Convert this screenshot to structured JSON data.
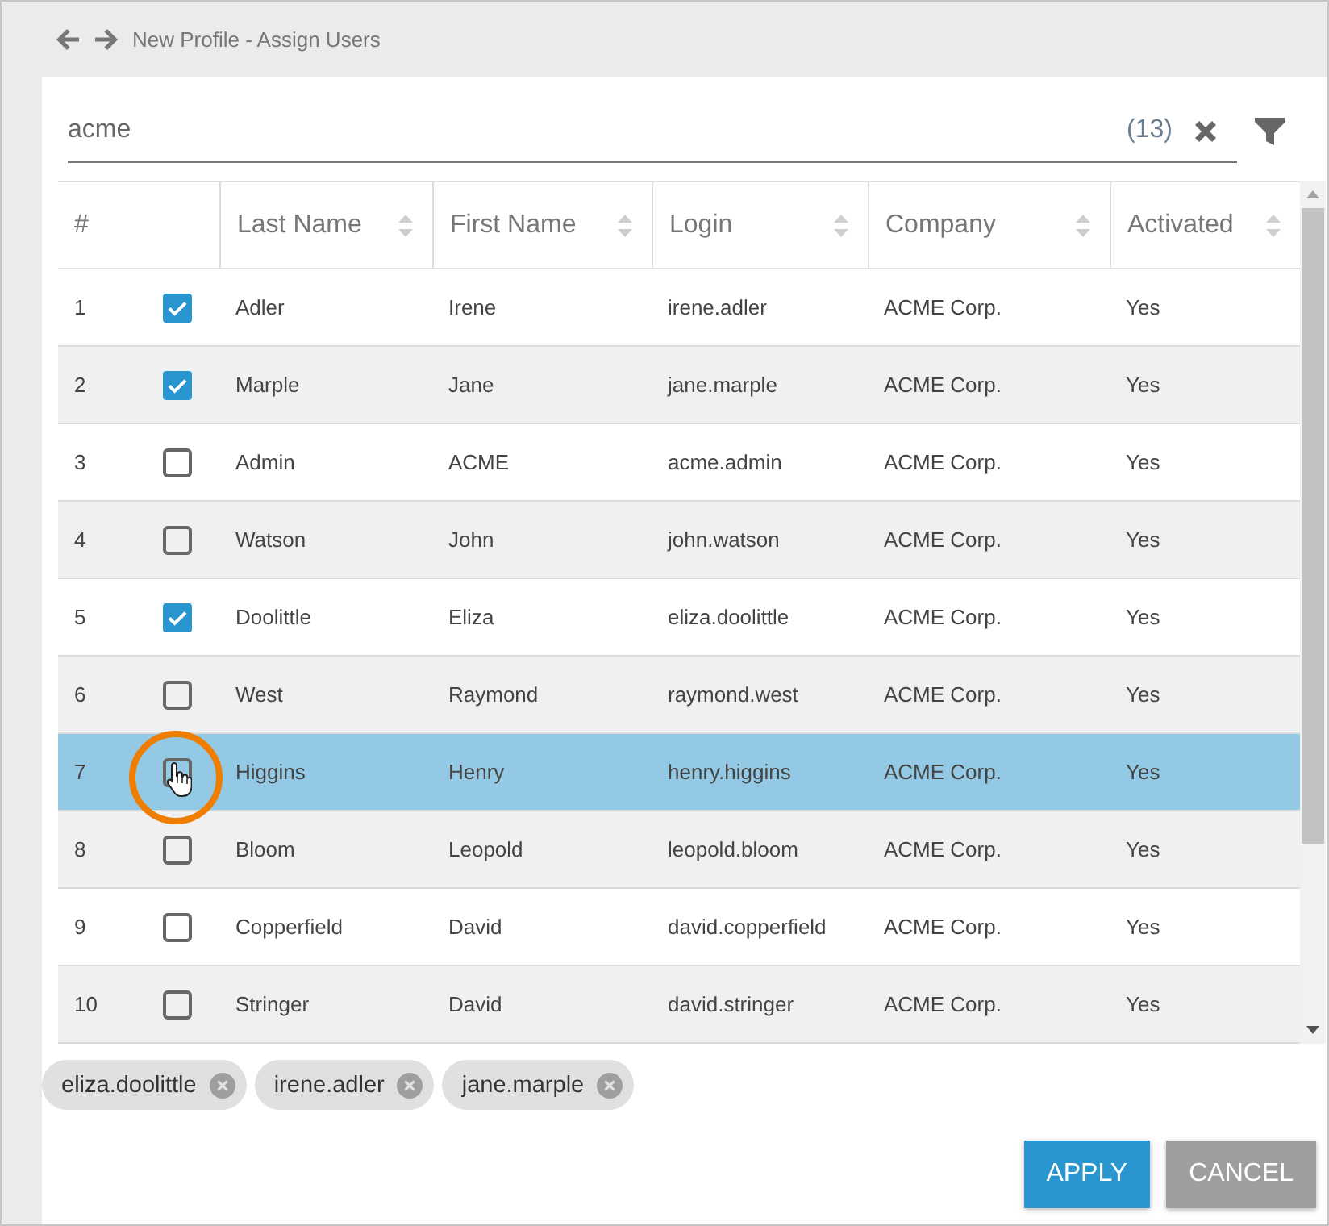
{
  "header": {
    "title": "New Profile - Assign Users"
  },
  "search": {
    "value": "acme",
    "count": "(13)"
  },
  "table": {
    "columns": [
      {
        "label": "#",
        "sortable": false
      },
      {
        "label": "Last Name",
        "sortable": true
      },
      {
        "label": "First Name",
        "sortable": true
      },
      {
        "label": "Login",
        "sortable": true
      },
      {
        "label": "Company",
        "sortable": true
      },
      {
        "label": "Activated",
        "sortable": true
      }
    ],
    "rows": [
      {
        "checked": true,
        "selected": false,
        "pointer": false,
        "cells": [
          "1",
          "Adler",
          "Irene",
          "irene.adler",
          "ACME Corp.",
          "Yes"
        ]
      },
      {
        "checked": true,
        "selected": false,
        "pointer": false,
        "cells": [
          "2",
          "Marple",
          "Jane",
          "jane.marple",
          "ACME Corp.",
          "Yes"
        ]
      },
      {
        "checked": false,
        "selected": false,
        "pointer": false,
        "cells": [
          "3",
          "Admin",
          "ACME",
          "acme.admin",
          "ACME Corp.",
          "Yes"
        ]
      },
      {
        "checked": false,
        "selected": false,
        "pointer": false,
        "cells": [
          "4",
          "Watson",
          "John",
          "john.watson",
          "ACME Corp.",
          "Yes"
        ]
      },
      {
        "checked": true,
        "selected": false,
        "pointer": false,
        "cells": [
          "5",
          "Doolittle",
          "Eliza",
          "eliza.doolittle",
          "ACME Corp.",
          "Yes"
        ]
      },
      {
        "checked": false,
        "selected": false,
        "pointer": false,
        "cells": [
          "6",
          "West",
          "Raymond",
          "raymond.west",
          "ACME Corp.",
          "Yes"
        ]
      },
      {
        "checked": false,
        "selected": true,
        "pointer": true,
        "cells": [
          "7",
          "Higgins",
          "Henry",
          "henry.higgins",
          "ACME Corp.",
          "Yes"
        ]
      },
      {
        "checked": false,
        "selected": false,
        "pointer": false,
        "cells": [
          "8",
          "Bloom",
          "Leopold",
          "leopold.bloom",
          "ACME Corp.",
          "Yes"
        ]
      },
      {
        "checked": false,
        "selected": false,
        "pointer": false,
        "cells": [
          "9",
          "Copperfield",
          "David",
          "david.copperfield",
          "ACME Corp.",
          "Yes"
        ]
      },
      {
        "checked": false,
        "selected": false,
        "pointer": false,
        "cells": [
          "10",
          "Stringer",
          "David",
          "david.stringer",
          "ACME Corp.",
          "Yes"
        ]
      }
    ]
  },
  "chips": [
    {
      "label": "eliza.doolittle"
    },
    {
      "label": "irene.adler"
    },
    {
      "label": "jane.marple"
    }
  ],
  "buttons": [
    {
      "label": "APPLY",
      "kind": "primary"
    },
    {
      "label": "CANCEL",
      "kind": "secondary"
    }
  ]
}
